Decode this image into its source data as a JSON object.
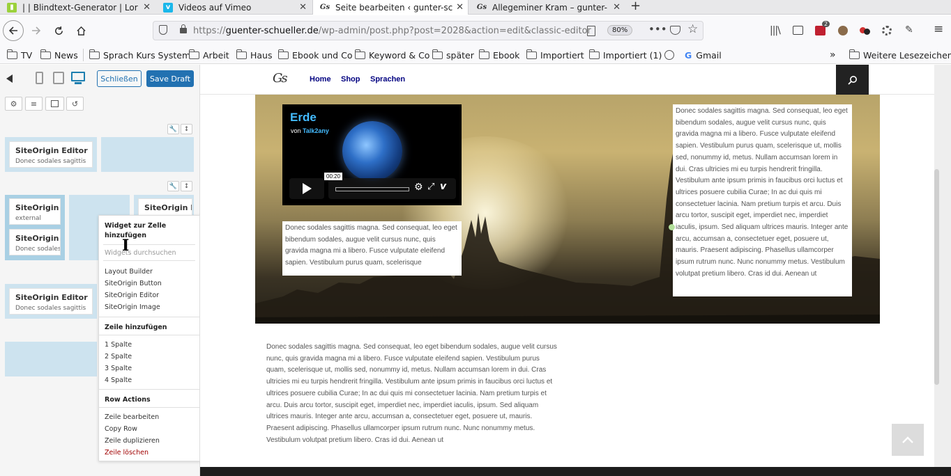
{
  "browser": {
    "tabs": [
      {
        "title": "| | Blindtext-Generator | Lor",
        "icon": "blindtext-favicon-icon"
      },
      {
        "title": "Videos auf Vimeo",
        "icon": "vimeo-favicon-icon"
      },
      {
        "title": "Seite bearbeiten ‹ gunter-sc",
        "icon": "gs-favicon-icon"
      },
      {
        "title": "Allegeminer Kram – gunter-",
        "icon": "gs-favicon-icon"
      }
    ],
    "url_prefix": "https://",
    "url_host": "guenter-schueller.de",
    "url_path": "/wp-admin/post.php?post=2028&action=edit&classic-editor",
    "zoom": "80%",
    "notification_count": "2",
    "bookmarks": [
      "TV",
      "News",
      "Sprach Kurs System",
      "Arbeit",
      "Haus",
      "Ebook und Co",
      "Keyword & Co",
      "später",
      "Ebook",
      "Importiert",
      "Importiert (1)",
      "Gmail"
    ],
    "more_bookmarks": "Weitere Lesezeichen"
  },
  "editor": {
    "close_label": "Schließen",
    "save_draft_label": "Save Draft",
    "widgets": {
      "row1": {
        "title": "SiteOrigin Editor",
        "sub": "Donec sodales sagittis"
      },
      "row2a": {
        "title": "SiteOrigin Vi",
        "sub": "external"
      },
      "row2b": {
        "title": "SiteOrigin Ed",
        "sub": "Donec sodales"
      },
      "row2c": {
        "title": "SiteOrigin Ed"
      },
      "row3": {
        "title": "SiteOrigin Editor",
        "sub": "Donec sodales sagittis"
      }
    },
    "context_menu": {
      "heading_widget": "Widget zur Zelle hinzufügen",
      "search_placeholder": "Widgets durchsuchen",
      "widget_items": [
        "Layout Builder",
        "SiteOrigin Button",
        "SiteOrigin Editor",
        "SiteOrigin Image"
      ],
      "heading_row": "Zeile hinzufügen",
      "row_items": [
        "1 Spalte",
        "2 Spalte",
        "3 Spalte",
        "4 Spalte"
      ],
      "heading_actions": "Row Actions",
      "action_items": [
        "Zeile bearbeiten",
        "Copy Row",
        "Zeile duplizieren"
      ],
      "delete_label": "Zeile löschen"
    }
  },
  "site": {
    "logo": "Gs",
    "nav": [
      "Home",
      "Shop",
      "Sprachen"
    ],
    "video": {
      "title": "Erde",
      "by": "von",
      "author": "Talk2any",
      "time": "00:20"
    },
    "lorem_right": "Donec sodales sagittis magna. Sed consequat, leo eget bibendum sodales, augue velit cursus nunc, quis gravida magna mi a libero. Fusce vulputate eleifend sapien. Vestibulum purus quam, scelerisque ut, mollis sed, nonummy id, metus. Nullam accumsan lorem in dui. Cras ultricies mi eu turpis hendrerit fringilla. Vestibulum ante ipsum primis in faucibus orci luctus et ultrices posuere cubilia Curae; In ac dui quis mi consectetuer lacinia. Nam pretium turpis et arcu. Duis arcu tortor, suscipit eget, imperdiet nec, imperdiet iaculis, ipsum. Sed aliquam ultrices mauris. Integer ante arcu, accumsan a, consectetuer eget, posuere ut, mauris. Praesent adipiscing. Phasellus ullamcorper ipsum rutrum nunc. Nunc nonummy metus. Vestibulum volutpat pretium libero. Cras id dui. Aenean ut",
    "lorem_left": "Donec sodales sagittis magna. Sed consequat, leo eget bibendum sodales, augue velit cursus nunc, quis gravida magna mi a libero. Fusce vulputate eleifend sapien. Vestibulum purus quam, scelerisque",
    "lorem_bottom": "Donec sodales sagittis magna. Sed consequat, leo eget bibendum sodales, augue velit cursus nunc, quis gravida magna mi a libero. Fusce vulputate eleifend sapien. Vestibulum purus quam, scelerisque ut, mollis sed, nonummy id, metus. Nullam accumsan lorem in dui. Cras ultricies mi eu turpis hendrerit fringilla. Vestibulum ante ipsum primis in faucibus orci luctus et ultrices posuere cubilia Curae; In ac dui quis mi consectetuer lacinia. Nam pretium turpis et arcu. Duis arcu tortor, suscipit eget, imperdiet nec, imperdiet iaculis, ipsum. Sed aliquam ultrices mauris. Integer ante arcu, accumsan a, consectetuer eget, posuere ut, mauris. Praesent adipiscing. Phasellus ullamcorper ipsum rutrum nunc. Nunc nonummy metus. Vestibulum volutpat pretium libero. Cras id dui. Aenean ut"
  },
  "colors": {
    "accent": "#2271b1",
    "nav_link": "#000080",
    "video_title": "#44bbff",
    "delete": "#a00000"
  }
}
